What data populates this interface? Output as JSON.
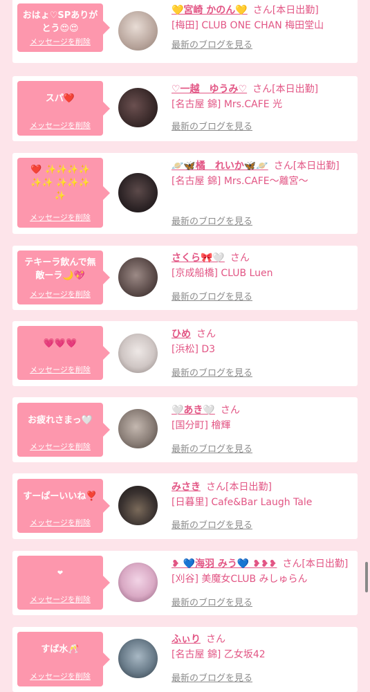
{
  "delete_label": "メッセージを削除",
  "blog_label": "最新のブログを見る",
  "san_label": "さん",
  "items": [
    {
      "message": "おはょ♡SPありがとう😍😍",
      "name": "💛宮崎 かのん💛",
      "status": "[本日出勤]",
      "shop": "[梅田] CLUB ONE CHAN 梅田堂山",
      "avatar_color": "#b8a59c"
    },
    {
      "message": "スパ❤️",
      "name": "♡一越　ゆうみ♡",
      "status": "[本日出勤]",
      "shop": "[名古屋 錦] Mrs.CAFE 光",
      "avatar_color": "#3a2a2a"
    },
    {
      "message": "❤️ ✨✨✨✨✨✨ ✨✨✨✨",
      "name": "🪐🦋橘　れいか🦋🪐",
      "status": "[本日出勤]",
      "shop": "[名古屋 錦] Mrs.CAFE〜離宮〜",
      "avatar_color": "#2d2426"
    },
    {
      "message": "テキーラ飲んで無敵ーラ🌙💖",
      "name": "さくら🎀🤍",
      "status": "",
      "shop": "[京成船橋] CLUB Luen",
      "avatar_color": "#5a4a48"
    },
    {
      "message": "💗💗💗",
      "name": "ひめ",
      "status": "",
      "shop": "[浜松] D3",
      "avatar_color": "#cfc6c4"
    },
    {
      "message": "お疲れさまっ🤍",
      "name": "🤍あき🤍",
      "status": "",
      "shop": "[国分町] 檜輝",
      "avatar_color": "#8a7e77"
    },
    {
      "message": "すーぱーいいね❣️",
      "name": "みさき",
      "status": "[本日出勤]",
      "shop": "[日暮里] Cafe&Bar Laugh Tale",
      "avatar_color": "#3a3230"
    },
    {
      "message": "❤",
      "name": "❥ 💙海羽 みう💙 ❥❥❥",
      "status": "[本日出勤]",
      "shop": "[刈谷] 美魔女CLUB みしゅらん",
      "avatar_color": "#d9a9c4"
    },
    {
      "message": "すば水🥂",
      "name": "ふぃり",
      "status": "",
      "shop": "[名古屋 錦] 乙女坂42",
      "avatar_color": "#6a7c8a"
    }
  ]
}
